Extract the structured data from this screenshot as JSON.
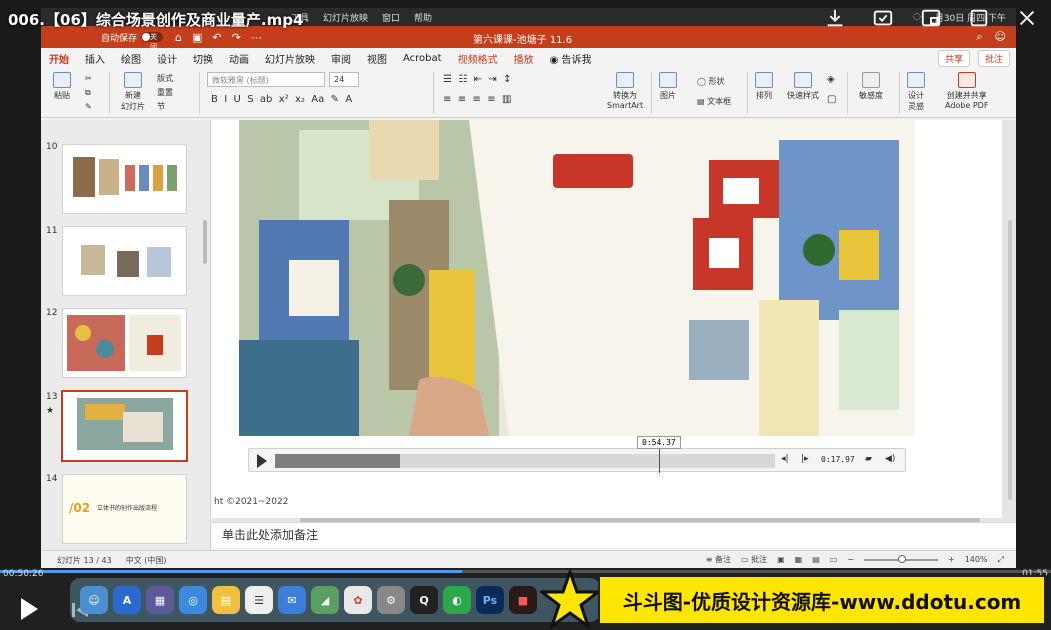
{
  "overlay": {
    "video_title": "006.【06】综合场景创作及商业量产.mp4"
  },
  "menubar": {
    "items": [
      "工具",
      "幻灯片放映",
      "窗口",
      "帮助"
    ],
    "clock": "月30日 周四 下午"
  },
  "titlebar": {
    "autosave_label": "自动保存",
    "autosave_state": "关闭",
    "doc_title": "第六课课-池塘子 11.6"
  },
  "tabs": [
    "开始",
    "插入",
    "绘图",
    "设计",
    "切换",
    "动画",
    "幻灯片放映",
    "审阅",
    "视图",
    "Acrobat",
    "视频格式",
    "播放",
    "告诉我"
  ],
  "share": {
    "share_label": "共享",
    "comment_label": "批注"
  },
  "ribbon": {
    "paste": "粘贴",
    "new_slide": "新建\n幻灯片",
    "layout": "版式",
    "reset": "重置",
    "section": "节",
    "font_name": "微软雅黑 (标题)",
    "font_size": "24",
    "convert_smartart": "转换为\nSmartArt",
    "picture": "图片",
    "shape": "形状",
    "textbox": "文本框",
    "arrange": "排列",
    "quick_styles": "快速样式",
    "sensitivity": "敏感度",
    "designer": "设计\n灵感",
    "create_pdf": "创建并共享\nAdobe PDF"
  },
  "thumbnails": [
    {
      "num": "10",
      "label": ""
    },
    {
      "num": "11",
      "label": ""
    },
    {
      "num": "12",
      "label": ""
    },
    {
      "num": "13",
      "label": "",
      "selected": true
    },
    {
      "num": "14",
      "label": "立体书的创作出版流程",
      "badge": "/02"
    }
  ],
  "slide": {
    "copyright": "ht ©2021~2022",
    "notes_placeholder": "单击此处添加备注"
  },
  "video_controls": {
    "hover_time": "0:54.37",
    "current_time": "0:17.97",
    "progress_pct": 25
  },
  "statusbar": {
    "slide_info": "幻灯片 13 / 43",
    "language": "中文 (中国)",
    "notes": "备注",
    "comments": "批注",
    "zoom": "140%"
  },
  "player": {
    "elapsed": "00:50:26",
    "remaining": "01:55",
    "progress_pct": 44
  },
  "banner": {
    "text": "斗斗图-优质设计资源库-www.ddotu.com"
  },
  "colors": {
    "accent": "#c43e1c",
    "banner_bg": "#ffe600",
    "player_progress": "#4a9be8"
  }
}
